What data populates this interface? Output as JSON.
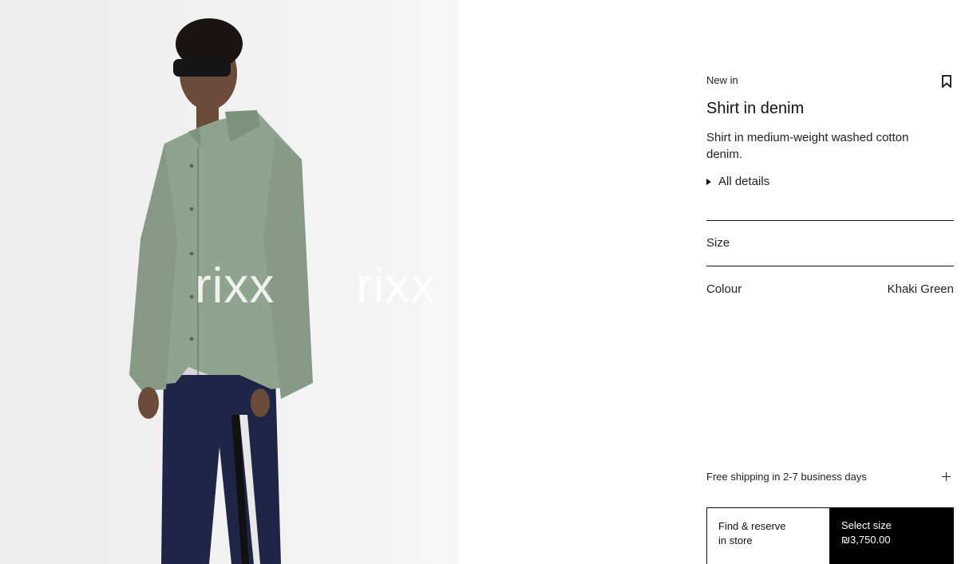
{
  "image": {
    "watermark_left": "rixx",
    "watermark_right": "rixx"
  },
  "product": {
    "badge": "New in",
    "title": "Shirt in denim",
    "description": "Shirt in medium-weight washed cotton denim.",
    "details_label": "All details",
    "size_label": "Size",
    "colour_label": "Colour",
    "colour_value": "Khaki Green"
  },
  "shipping": {
    "label": "Free shipping in 2-7 business days"
  },
  "actions": {
    "find_line1": "Find & reserve",
    "find_line2": "in store",
    "select_label": "Select size",
    "price": "₪3,750.00"
  },
  "icons": {
    "bookmark": "bookmark-icon",
    "expand": "plus-icon",
    "disclosure": "triangle-right-icon"
  },
  "colors": {
    "shirt": "#8fa48e",
    "trousers": "#1f2547",
    "primary_button": "#000000"
  }
}
